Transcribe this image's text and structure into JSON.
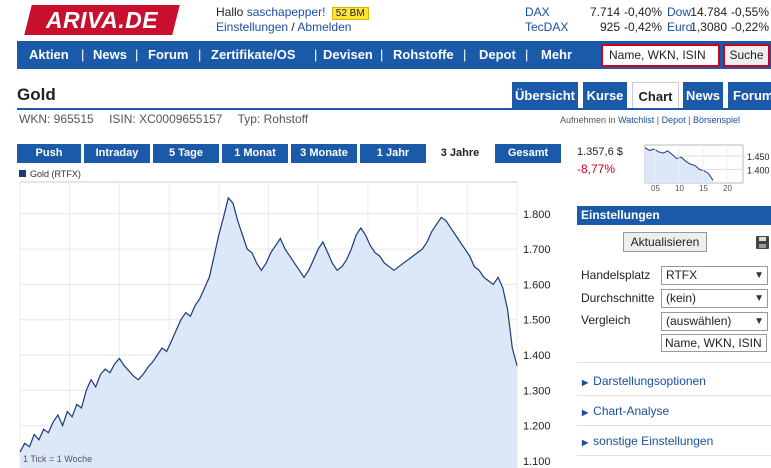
{
  "header": {
    "logo": "ARIVA.DE",
    "greeting": "Hallo ",
    "username": "saschapepper!",
    "storage_badge": "52 BM",
    "settings_link": "Einstellungen",
    "separator": "/",
    "logout_link": "Abmelden"
  },
  "indices": [
    {
      "name": "DAX",
      "value": "7.714",
      "change": "-0,40%"
    },
    {
      "name": "Dow",
      "value": "14.784",
      "change": "-0,55%"
    },
    {
      "name": "TecDAX",
      "value": "925",
      "change": "-0,42%"
    },
    {
      "name": "Euro",
      "value": "1,3080",
      "change": "-0,22%"
    }
  ],
  "nav": {
    "items": [
      "Aktien",
      "News",
      "Forum",
      "Zertifikate/OS",
      "Devisen",
      "Rohstoffe",
      "Depot",
      "Mehr"
    ],
    "search_placeholder": "Name, WKN, ISIN",
    "search_button": "Suche"
  },
  "instrument": {
    "title": "Gold",
    "wkn": "WKN: 965515",
    "isin": "ISIN: XC0009655157",
    "type": "Typ: Rohstoff",
    "add_to": "Aufnehmen in",
    "watchlist": "Watchlist",
    "depot": "Depot",
    "boersenspiel": "Börsenspiel"
  },
  "tabs": [
    "Übersicht",
    "Kurse",
    "Chart",
    "News",
    "Forum"
  ],
  "active_tab": "Chart",
  "ranges": [
    "Push",
    "Intraday",
    "5 Tage",
    "1 Monat",
    "3 Monate",
    "1 Jahr",
    "3 Jahre",
    "Gesamt"
  ],
  "active_range": "3 Jahre",
  "chart_footnote": "1 Tick = 1 Woche",
  "chart_data": {
    "type": "area",
    "legend": [
      "Gold (RTFX)"
    ],
    "series": [
      {
        "name": "Gold (RTFX)",
        "values": [
          1125,
          1150,
          1140,
          1175,
          1160,
          1190,
          1180,
          1210,
          1230,
          1200,
          1240,
          1225,
          1260,
          1250,
          1300,
          1330,
          1310,
          1345,
          1360,
          1350,
          1375,
          1390,
          1370,
          1355,
          1340,
          1330,
          1345,
          1365,
          1380,
          1400,
          1420,
          1410,
          1440,
          1470,
          1500,
          1520,
          1510,
          1540,
          1560,
          1590,
          1620,
          1680,
          1740,
          1790,
          1845,
          1830,
          1780,
          1740,
          1700,
          1690,
          1660,
          1640,
          1660,
          1690,
          1710,
          1730,
          1700,
          1680,
          1660,
          1640,
          1620,
          1640,
          1670,
          1700,
          1720,
          1690,
          1660,
          1640,
          1650,
          1670,
          1700,
          1740,
          1760,
          1740,
          1710,
          1690,
          1680,
          1660,
          1650,
          1640,
          1650,
          1660,
          1670,
          1680,
          1690,
          1700,
          1720,
          1750,
          1770,
          1790,
          1780,
          1760,
          1740,
          1720,
          1700,
          1680,
          1650,
          1640,
          1620,
          1610,
          1600,
          1620,
          1590,
          1530,
          1420,
          1370
        ]
      }
    ],
    "ylim": [
      1080,
      1890
    ],
    "yticks": [
      "1.800",
      "1.700",
      "1.600",
      "1.500",
      "1.400",
      "1.300",
      "1.200",
      "1.100"
    ],
    "ytick_values": [
      1800,
      1700,
      1600,
      1500,
      1400,
      1300,
      1200,
      1100
    ],
    "grid": true
  },
  "mini_chart": {
    "price": "1.357,6 $",
    "change": "-8,77%",
    "xticks": [
      "05",
      "10",
      "15",
      "20"
    ],
    "yticks": [
      "1.450",
      "1.400"
    ],
    "values": [
      1480,
      1470,
      1475,
      1465,
      1460,
      1468,
      1455,
      1440,
      1445,
      1430,
      1420,
      1415,
      1400,
      1395,
      1385,
      1360
    ]
  },
  "settings": {
    "header": "Einstellungen",
    "update_button": "Aktualisieren",
    "handelsplatz_label": "Handelsplatz",
    "handelsplatz_value": "RTFX",
    "durchschnitte_label": "Durchschnitte",
    "durchschnitte_value": "(kein)",
    "vergleich_label": "Vergleich",
    "vergleich_value": "(auswählen)",
    "vergleich_input": "Name, WKN, ISIN",
    "sections": [
      "Darstellungsoptionen",
      "Chart-Analyse",
      "sonstige Einstellungen"
    ]
  },
  "colors": {
    "brand_red": "#c8102e",
    "nav_blue": "#1a5aa8",
    "negative": "#d0021b",
    "chart_fill": "#dce8f8",
    "chart_line": "#1a3a7a"
  }
}
